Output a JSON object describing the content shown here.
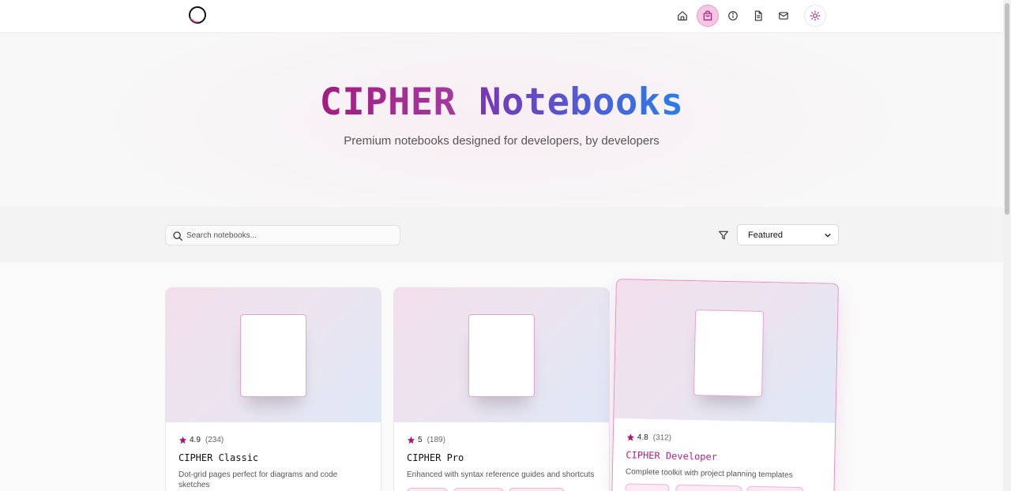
{
  "nav": {
    "items": [
      {
        "icon": "home-icon",
        "label": "Home"
      },
      {
        "icon": "shopping-bag-icon",
        "label": "Shop",
        "active": true
      },
      {
        "icon": "info-icon",
        "label": "About"
      },
      {
        "icon": "document-icon",
        "label": "Docs"
      },
      {
        "icon": "mail-icon",
        "label": "Contact"
      }
    ],
    "theme_icon": "sun-icon"
  },
  "hero": {
    "title_part1": "CIPHER",
    "title_part2": "Notebooks",
    "subtitle": "Premium notebooks designed for developers, by developers"
  },
  "filters": {
    "search_placeholder": "Search notebooks...",
    "search_value": "",
    "sort_selected": "Featured",
    "filter_icon": "filter-icon"
  },
  "products": [
    {
      "rating": "4.9",
      "reviews": "(234)",
      "title": "CIPHER Classic",
      "description": "Dot-grid pages perfect for diagrams and code sketches"
    },
    {
      "rating": "5",
      "reviews": "(189)",
      "title": "CIPHER Pro",
      "description": "Enhanced with syntax reference guides and shortcuts"
    },
    {
      "rating": "4.8",
      "reviews": "(312)",
      "title": "CIPHER Developer",
      "description": "Complete toolkit with project planning templates"
    }
  ],
  "colors": {
    "accent": "#a21c80",
    "gradient_end": "#2a7ee8",
    "active_nav_bg": "#f6c6e2",
    "star": "#a8167a"
  }
}
